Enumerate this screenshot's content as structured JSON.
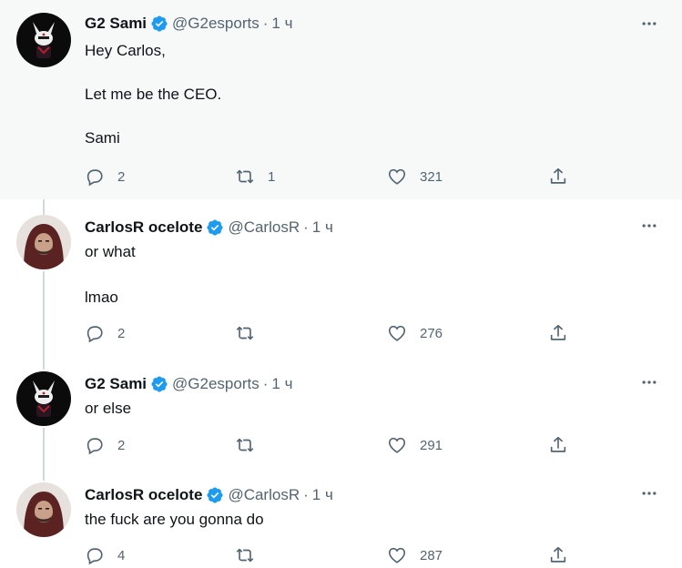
{
  "colors": {
    "verified": "#1d9bf0",
    "icon": "#536471",
    "highlight_bg": "#f7f9f9"
  },
  "tweets": [
    {
      "name": "G2 Sami",
      "handle": "@G2esports",
      "separator": "·",
      "time": "1 ч",
      "lines": [
        "Hey Carlos,",
        "Let me be the CEO.",
        "Sami"
      ],
      "replies": "2",
      "retweets": "1",
      "likes": "321",
      "avatar": "g2-samurai-avatar"
    },
    {
      "name": "CarlosR ocelote",
      "handle": "@CarlosR",
      "separator": "·",
      "time": "1 ч",
      "lines": [
        "or what",
        "lmao"
      ],
      "replies": "2",
      "retweets": "",
      "likes": "276",
      "avatar": "carlos-hooded-avatar"
    },
    {
      "name": "G2 Sami",
      "handle": "@G2esports",
      "separator": "·",
      "time": "1 ч",
      "lines": [
        "or else"
      ],
      "replies": "2",
      "retweets": "",
      "likes": "291",
      "avatar": "g2-samurai-avatar"
    },
    {
      "name": "CarlosR ocelote",
      "handle": "@CarlosR",
      "separator": "·",
      "time": "1 ч",
      "lines": [
        "the fuck are you gonna do"
      ],
      "replies": "4",
      "retweets": "",
      "likes": "287",
      "avatar": "carlos-hooded-avatar"
    }
  ]
}
